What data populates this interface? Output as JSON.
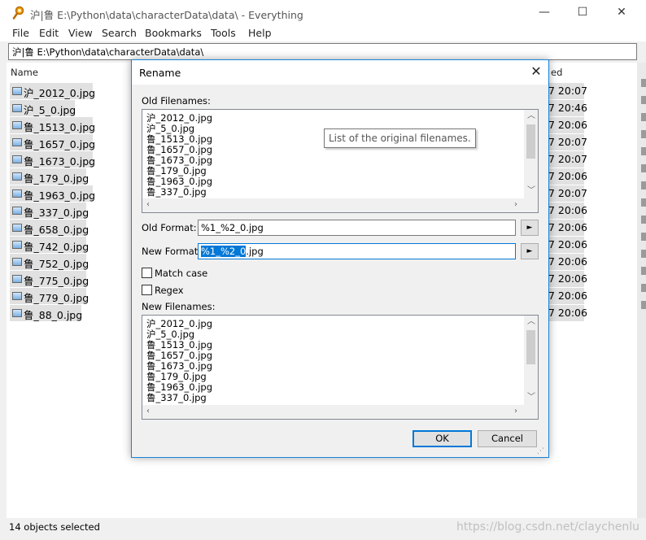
{
  "window": {
    "title": "沪|鲁 E:\\Python\\data\\characterData\\data\\  - Everything",
    "minimize": "—",
    "maximize": "☐",
    "close": "✕"
  },
  "menu": [
    "File",
    "Edit",
    "View",
    "Search",
    "Bookmarks",
    "Tools",
    "Help"
  ],
  "search": {
    "value": "沪|鲁 E:\\Python\\data\\characterData\\data\\"
  },
  "columns": {
    "name": "Name",
    "date_partial": "ed"
  },
  "files": [
    {
      "name": "沪_2012_0.jpg",
      "date": "7 20:07"
    },
    {
      "name": "沪_5_0.jpg",
      "date": "7 20:46"
    },
    {
      "name": "鲁_1513_0.jpg",
      "date": "7 20:06"
    },
    {
      "name": "鲁_1657_0.jpg",
      "date": "7 20:07"
    },
    {
      "name": "鲁_1673_0.jpg",
      "date": "7 20:07"
    },
    {
      "name": "鲁_179_0.jpg",
      "date": "7 20:06"
    },
    {
      "name": "鲁_1963_0.jpg",
      "date": "7 20:07"
    },
    {
      "name": "鲁_337_0.jpg",
      "date": "7 20:06"
    },
    {
      "name": "鲁_658_0.jpg",
      "date": "7 20:06"
    },
    {
      "name": "鲁_742_0.jpg",
      "date": "7 20:06"
    },
    {
      "name": "鲁_752_0.jpg",
      "date": "7 20:06"
    },
    {
      "name": "鲁_775_0.jpg",
      "date": "7 20:06"
    },
    {
      "name": "鲁_779_0.jpg",
      "date": "7 20:06"
    },
    {
      "name": "鲁_88_0.jpg",
      "date": "7 20:06"
    }
  ],
  "status": {
    "text": "14 objects selected",
    "watermark": "https://blog.csdn.net/claychenlu"
  },
  "dialog": {
    "title": "Rename",
    "close": "✕",
    "old_filenames_label": "Old Filenames:",
    "old_filenames": [
      "沪_2012_0.jpg",
      "沪_5_0.jpg",
      "鲁_1513_0.jpg",
      "鲁_1657_0.jpg",
      "鲁_1673_0.jpg",
      "鲁_179_0.jpg",
      "鲁_1963_0.jpg",
      "鲁_337_0.jpg"
    ],
    "tooltip": "List of the original filenames.",
    "old_format_label": "Old Format:",
    "old_format_value": "%1_%2_0.jpg",
    "new_format_label": "New Format:",
    "new_format_selected": "%1_%2_0",
    "new_format_rest": ".jpg",
    "arrow": "►",
    "match_case_label": "Match case",
    "match_case_checked": false,
    "regex_label": "Regex",
    "regex_checked": false,
    "new_filenames_label": "New Filenames:",
    "new_filenames": [
      "沪_2012_0.jpg",
      "沪_5_0.jpg",
      "鲁_1513_0.jpg",
      "鲁_1657_0.jpg",
      "鲁_1673_0.jpg",
      "鲁_179_0.jpg",
      "鲁_1963_0.jpg",
      "鲁_337_0.jpg"
    ],
    "ok_label": "OK",
    "cancel_label": "Cancel"
  }
}
